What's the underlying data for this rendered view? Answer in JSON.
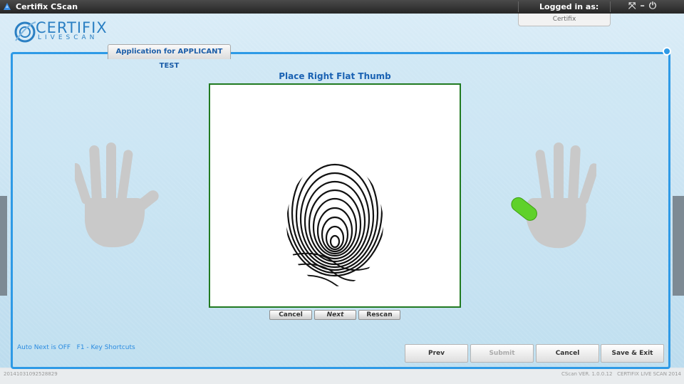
{
  "window": {
    "title": "Certifix CScan",
    "logged_in_label": "Logged in as:",
    "user": "Certifix",
    "controls": "⌘ – ⏻"
  },
  "logo": {
    "name": "CERTIFIX",
    "sub": "LIVESCAN"
  },
  "tab": {
    "label": "Application for APPLICANT TEST"
  },
  "scan": {
    "instruction": "Place Right Flat Thumb",
    "buttons": {
      "cancel": "Cancel",
      "next": "Next",
      "rescan": "Rescan"
    },
    "active_finger": "right-thumb",
    "active_color": "#5fd12a"
  },
  "status": {
    "text": "Auto Next is OFF   F1 - Key Shortcuts"
  },
  "actions": {
    "prev": "Prev",
    "submit": "Submit",
    "cancel": "Cancel",
    "save_exit": "Save & Exit"
  },
  "footer": {
    "id": "20141031092528829",
    "version": "CScan VER. 1.0.0.12   CERTIFIX LIVE SCAN 2014"
  },
  "colors": {
    "accent": "#2e9ae6",
    "scan_border": "#217a21",
    "hand_gray": "#c9c9c9"
  }
}
